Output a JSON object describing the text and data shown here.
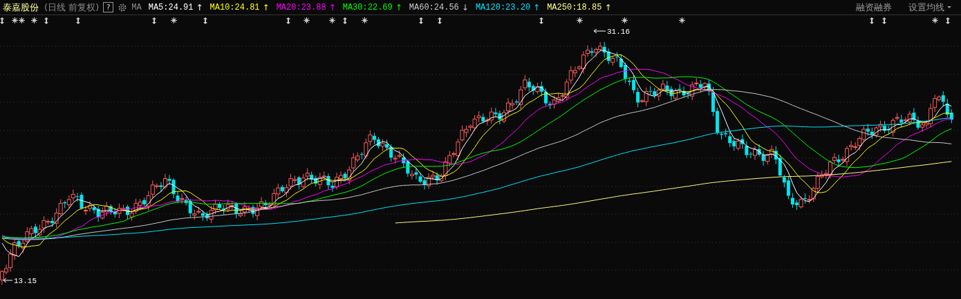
{
  "stock": {
    "name": "泰嘉股份",
    "period": "(日线 前复权)"
  },
  "help_button": "?",
  "ma_label": "MA",
  "moving_averages": [
    {
      "label": "MA5:24.91",
      "arrow": "↑",
      "color": "#ffffff"
    },
    {
      "label": "MA10:24.81",
      "arrow": "↑",
      "color": "#ffff00"
    },
    {
      "label": "MA20:23.88",
      "arrow": "↑",
      "color": "#ff00ff"
    },
    {
      "label": "MA30:22.69",
      "arrow": "↑",
      "color": "#00ff00"
    },
    {
      "label": "MA60:24.56",
      "arrow": "↓",
      "color": "#c8c8c8"
    },
    {
      "label": "MA120:23.20",
      "arrow": "↑",
      "color": "#00e5ff"
    },
    {
      "label": "MA250:18.85",
      "arrow": "↑",
      "color": "#ffff80"
    }
  ],
  "toolbar_right": [
    {
      "label": "融资融券",
      "dropdown": false
    },
    {
      "label": "设置均线",
      "dropdown": true
    }
  ],
  "chart": {
    "high_label": "31.16",
    "low_label": "13.15"
  }
}
